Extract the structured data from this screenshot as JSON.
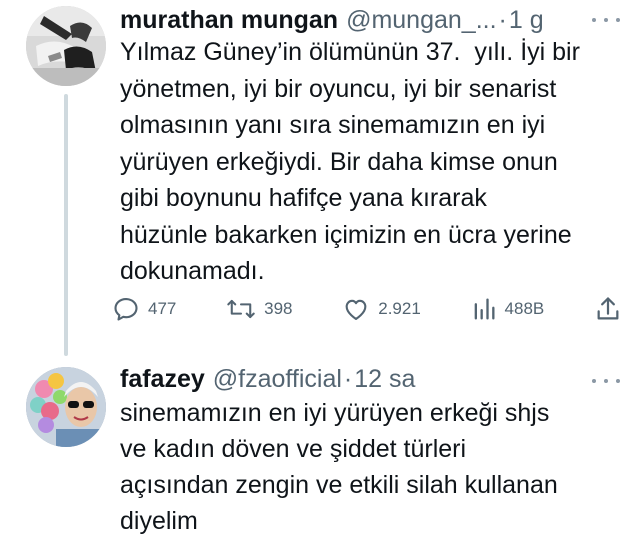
{
  "tweets": [
    {
      "name": "murathan mungan",
      "handle": "@mungan_...",
      "separator": "·",
      "time": "1 g",
      "text": "Yılmaz Güney’in ölümünün 37.  yılı. İyi bir\nyönetmen, iyi bir oyuncu, iyi bir senarist\nolmasının yanı sıra sinemamızın en iyi\nyürüyen erkeğiydi. Bir daha kimse onun\ngibi boynunu hafifçe yana kırarak\nhüzünle bakarken içimizin en ücra yerine\ndokunamadı.",
      "avatar_icon": "profile-photo",
      "actions": {
        "reply": {
          "icon": "reply-icon",
          "count": "477"
        },
        "retweet": {
          "icon": "retweet-icon",
          "count": "398"
        },
        "like": {
          "icon": "heart-icon",
          "count": "2.921"
        },
        "views": {
          "icon": "views-icon",
          "count": "488B"
        },
        "share": {
          "icon": "share-icon"
        }
      }
    },
    {
      "name": "fafazey",
      "handle": "@fzaofficial",
      "separator": "·",
      "time": "12 sa",
      "text": "sinemamızın en iyi yürüyen erkeği shjs\nve kadın döven ve şiddet türleri\naçısından zengin ve etkili silah kullanan\ndiyelim",
      "avatar_icon": "profile-photo"
    }
  ],
  "colors": {
    "text": "#0f1419",
    "secondary": "#536471",
    "thread_line": "#cfd9de",
    "background": "#ffffff"
  }
}
